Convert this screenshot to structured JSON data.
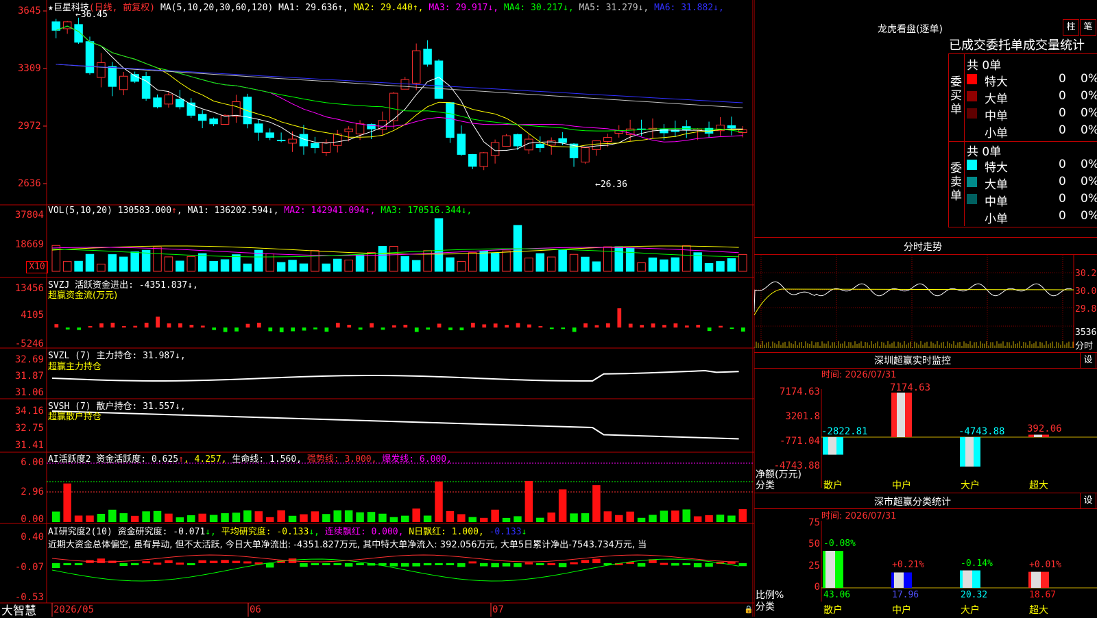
{
  "app": {
    "brand": "大智慧"
  },
  "main_chart": {
    "stock_label": "★巨星科技",
    "period_label": "(日线, 前复权)",
    "ma_params": "MA(5,10,20,30,60,120)",
    "ma_values": [
      {
        "label": "MA1:",
        "value": "29.636",
        "trend": "↑",
        "color": "#ffffff"
      },
      {
        "label": "MA2:",
        "value": "29.440",
        "trend": "↑",
        "color": "#ffff00"
      },
      {
        "label": "MA3:",
        "value": "29.917",
        "trend": "↓",
        "color": "#ff00ff"
      },
      {
        "label": "MA4:",
        "value": "30.217",
        "trend": "↓",
        "color": "#00ff00"
      },
      {
        "label": "MA5:",
        "value": "31.279",
        "trend": "↓",
        "color": "#c0c0c0"
      },
      {
        "label": "MA6:",
        "value": "31.882",
        "trend": "↓",
        "color": "#3030ff"
      }
    ],
    "y_ticks": [
      "3645",
      "3309",
      "2972",
      "2636"
    ],
    "high_label": "←36.45",
    "low_label": "←26.36",
    "x_ticks": [
      "2026/05",
      "06",
      "07"
    ]
  },
  "vol_panel": {
    "header": "VOL(5,10,20)",
    "value": "130583.000",
    "ma": [
      {
        "label": "MA1:",
        "value": "136202.594",
        "trend": "↓",
        "color": "#ffffff"
      },
      {
        "label": "MA2:",
        "value": "142941.094",
        "trend": "↑",
        "color": "#ff00ff"
      },
      {
        "label": "MA3:",
        "value": "170516.344",
        "trend": "↓",
        "color": "#00ff00"
      }
    ],
    "y_ticks": [
      "37804",
      "18669"
    ],
    "unit_badge": "X10"
  },
  "svzj_panel": {
    "header": "SVZJ  活跃资金进出: -4351.837↓,",
    "subtitle": "超赢资金流(万元)",
    "y_ticks": [
      "13456",
      "4105",
      "-5246"
    ]
  },
  "svzl_panel": {
    "header": "SVZL (7) 主力持仓: 31.987↓,",
    "subtitle": "超赢主力持仓",
    "y_ticks": [
      "32.69",
      "31.87",
      "31.06"
    ]
  },
  "svsh_panel": {
    "header": "SVSH (7) 散户持仓: 31.557↓,",
    "subtitle": "超赢散户持仓",
    "y_ticks": [
      "34.16",
      "32.75",
      "31.41"
    ]
  },
  "ai_active_panel": {
    "header_parts": [
      {
        "text": "AI活跃度2 资金活跃度: 0.625",
        "color": "#ffffff"
      },
      {
        "text": "↑",
        "color": "#ff3030"
      },
      {
        "text": ", 4.257,",
        "color": "#ffff00"
      },
      {
        "text": " 生命线: 1.560,",
        "color": "#ffffff"
      },
      {
        "text": " 强势线: 3.000,",
        "color": "#ff3030"
      },
      {
        "text": " 爆发线: 6.000,",
        "color": "#ff00ff"
      }
    ],
    "y_ticks": [
      "6.00",
      "2.96",
      "0.00"
    ]
  },
  "ai_research_panel": {
    "header_parts": [
      {
        "text": "AI研究度2(10) 资金研究度: -0.071",
        "color": "#ffffff"
      },
      {
        "text": "↓,",
        "color": "#00ff00"
      },
      {
        "text": " 平均研究度: -0.133",
        "color": "#ffff00"
      },
      {
        "text": "↓,",
        "color": "#00ff00"
      },
      {
        "text": " 连续飘红: 0.000,",
        "color": "#ff00ff"
      },
      {
        "text": " N日飘红: 1.000,",
        "color": "#ffff00"
      },
      {
        "text": " -0.133",
        "color": "#3030ff"
      },
      {
        "text": "↓",
        "color": "#00ff00"
      }
    ],
    "comment": "近期大资金总体偏空, 虽有异动, 但不太活跃, 今日大单净流出: -4351.827万元, 其中特大单净流入: 392.056万元, 大单5日累计净出-7543.734万元, 当",
    "y_ticks": [
      "0.40",
      "-0.07",
      "-0.53"
    ]
  },
  "dragon_tiger": {
    "title": "龙虎看盘(逐单)",
    "btn_bar": "柱",
    "btn_pen": "笔",
    "header": "已成交委托单成交量统计",
    "buy": {
      "total": "共 0单",
      "side_label": "委买单",
      "rows": [
        {
          "name": "特大",
          "count": "0",
          "pct": "0%",
          "color": "#ff0000"
        },
        {
          "name": "大单",
          "count": "0",
          "pct": "0%",
          "color": "#900000"
        },
        {
          "name": "中单",
          "count": "0",
          "pct": "0%",
          "color": "#600000"
        },
        {
          "name": "小单",
          "count": "0",
          "pct": "0%",
          "color": "#000000"
        }
      ]
    },
    "sell": {
      "total": "共 0单",
      "side_label": "委卖单",
      "rows": [
        {
          "name": "特大",
          "count": "0",
          "pct": "0%",
          "color": "#00ffff"
        },
        {
          "name": "大单",
          "count": "0",
          "pct": "0%",
          "color": "#008c8c"
        },
        {
          "name": "中单",
          "count": "0",
          "pct": "0%",
          "color": "#006060"
        },
        {
          "name": "小单",
          "count": "0",
          "pct": "0%",
          "color": "#000000"
        }
      ]
    }
  },
  "intraday": {
    "title": "分时走势",
    "y_ticks": [
      "30.22",
      "30.01",
      "29.81"
    ],
    "vol_tick": "3536",
    "vol_label": "分时"
  },
  "sz_monitor": {
    "title": "深圳超赢实时监控",
    "settings": "设",
    "time": "时间: 2026/07/31",
    "y_ticks": [
      "7174.63",
      "3201.8",
      "-771.04",
      "-4743.88"
    ],
    "ylabel": "净额(万元)",
    "xlabel": "分类",
    "categories": [
      "散户",
      "中户",
      "大户",
      "超大"
    ],
    "value_labels": [
      "-2822.81",
      "7174.63",
      "-4743.88",
      "392.06"
    ]
  },
  "sz_class": {
    "title": "深市超赢分类统计",
    "settings": "设",
    "time": "时间: 2026/07/31",
    "y_ticks": [
      "75",
      "50",
      "25",
      "0"
    ],
    "ylabel": "比例%",
    "xlabel": "分类",
    "categories": [
      "散户",
      "中户",
      "大户",
      "超大"
    ],
    "bottom_labels": [
      "43.06",
      "17.96",
      "20.32",
      "18.67"
    ],
    "top_labels": [
      "-0.08%",
      "+0.21%",
      "-0.14%",
      "+0.01%"
    ]
  },
  "chart_data": [
    {
      "type": "bar",
      "title": "深圳超赢实时监控",
      "categories": [
        "散户",
        "中户",
        "大户",
        "超大"
      ],
      "values": [
        -2822.81,
        7174.63,
        -4743.88,
        392.06
      ],
      "ylabel": "净额(万元)",
      "ylim": [
        -4743.88,
        7174.63
      ]
    },
    {
      "type": "bar",
      "title": "深市超赢分类统计",
      "categories": [
        "散户",
        "中户",
        "大户",
        "超大"
      ],
      "values": [
        43.06,
        17.96,
        20.32,
        18.67
      ],
      "ylabel": "比例%",
      "ylim": [
        0,
        75
      ]
    }
  ]
}
